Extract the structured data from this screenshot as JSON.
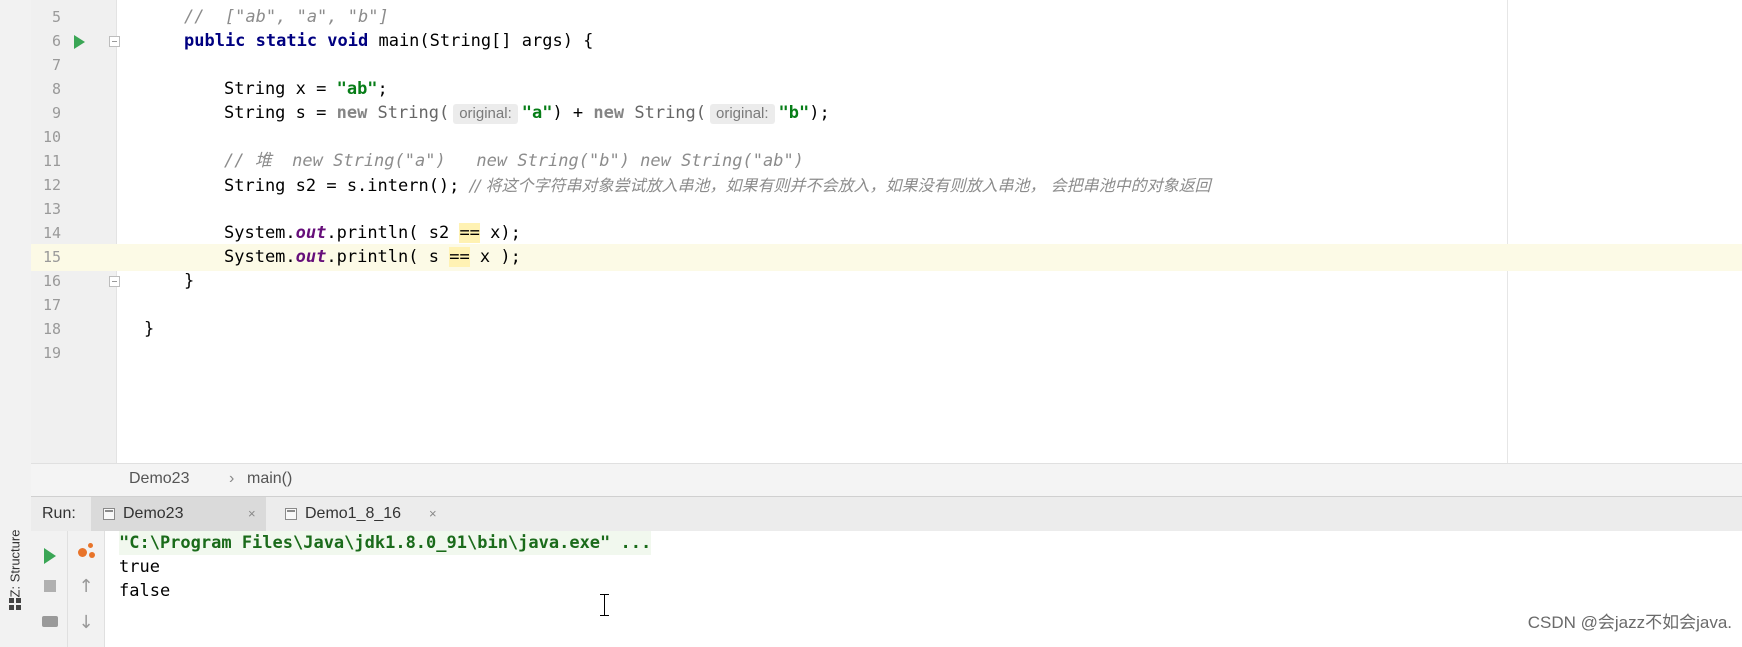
{
  "editor": {
    "current_line": "15",
    "lines": [
      {
        "num": "5"
      },
      {
        "num": "6",
        "seg": [
          "public static void",
          " main(String[] args) {"
        ]
      },
      {
        "num": "7"
      },
      {
        "num": "8",
        "seg": [
          "String x = ",
          "\"ab\"",
          ";"
        ]
      },
      {
        "num": "9",
        "seg": [
          "String s = ",
          "new",
          " String(",
          "original:",
          "\"a\"",
          ") + ",
          "new",
          " String(",
          "original:",
          "\"b\"",
          ");"
        ]
      },
      {
        "num": "10"
      },
      {
        "num": "11",
        "seg": [
          "// 堆  new String(\"a\")   new String(\"b\") new String(\"ab\")"
        ]
      },
      {
        "num": "12",
        "seg": [
          "String s2 = s.intern(); ",
          "// 将这个字符串对象尝试放入串池，如果有则并不会放入，如果没有则放入串池， 会把串池中的对象返回"
        ]
      },
      {
        "num": "13"
      },
      {
        "num": "14",
        "seg": [
          "System.",
          "out",
          ".println( s2 ",
          "==",
          " x);"
        ]
      },
      {
        "num": "15",
        "seg": [
          "System.",
          "out",
          ".println( s ",
          "==",
          " x );"
        ]
      },
      {
        "num": "16",
        "seg": [
          "}"
        ]
      },
      {
        "num": "17"
      },
      {
        "num": "18",
        "seg": [
          "}"
        ]
      },
      {
        "num": "19"
      }
    ],
    "line5_comment": "//  [\"ab\", \"a\", \"b\"]"
  },
  "breadcrumb": {
    "items": [
      "Demo23",
      "main()"
    ],
    "separator": "›"
  },
  "run_panel": {
    "label": "Run:",
    "tabs": [
      {
        "label": "Demo23",
        "close": "×",
        "active": true
      },
      {
        "label": "Demo1_8_16",
        "close": "×",
        "active": false
      }
    ],
    "console": {
      "command": "\"C:\\Program Files\\Java\\jdk1.8.0_91\\bin\\java.exe\" ...",
      "output": [
        "true",
        "false"
      ]
    }
  },
  "side_tool": {
    "structure_label": "Z: Structure"
  },
  "watermark": "CSDN @会jazz不如会java.",
  "colors": {
    "keyword": "#000080",
    "string": "#067d17",
    "comment": "#8c8c8c",
    "static_field": "#660e7a",
    "current_line_bg": "#fcfae6",
    "run_green": "#3aa655"
  }
}
